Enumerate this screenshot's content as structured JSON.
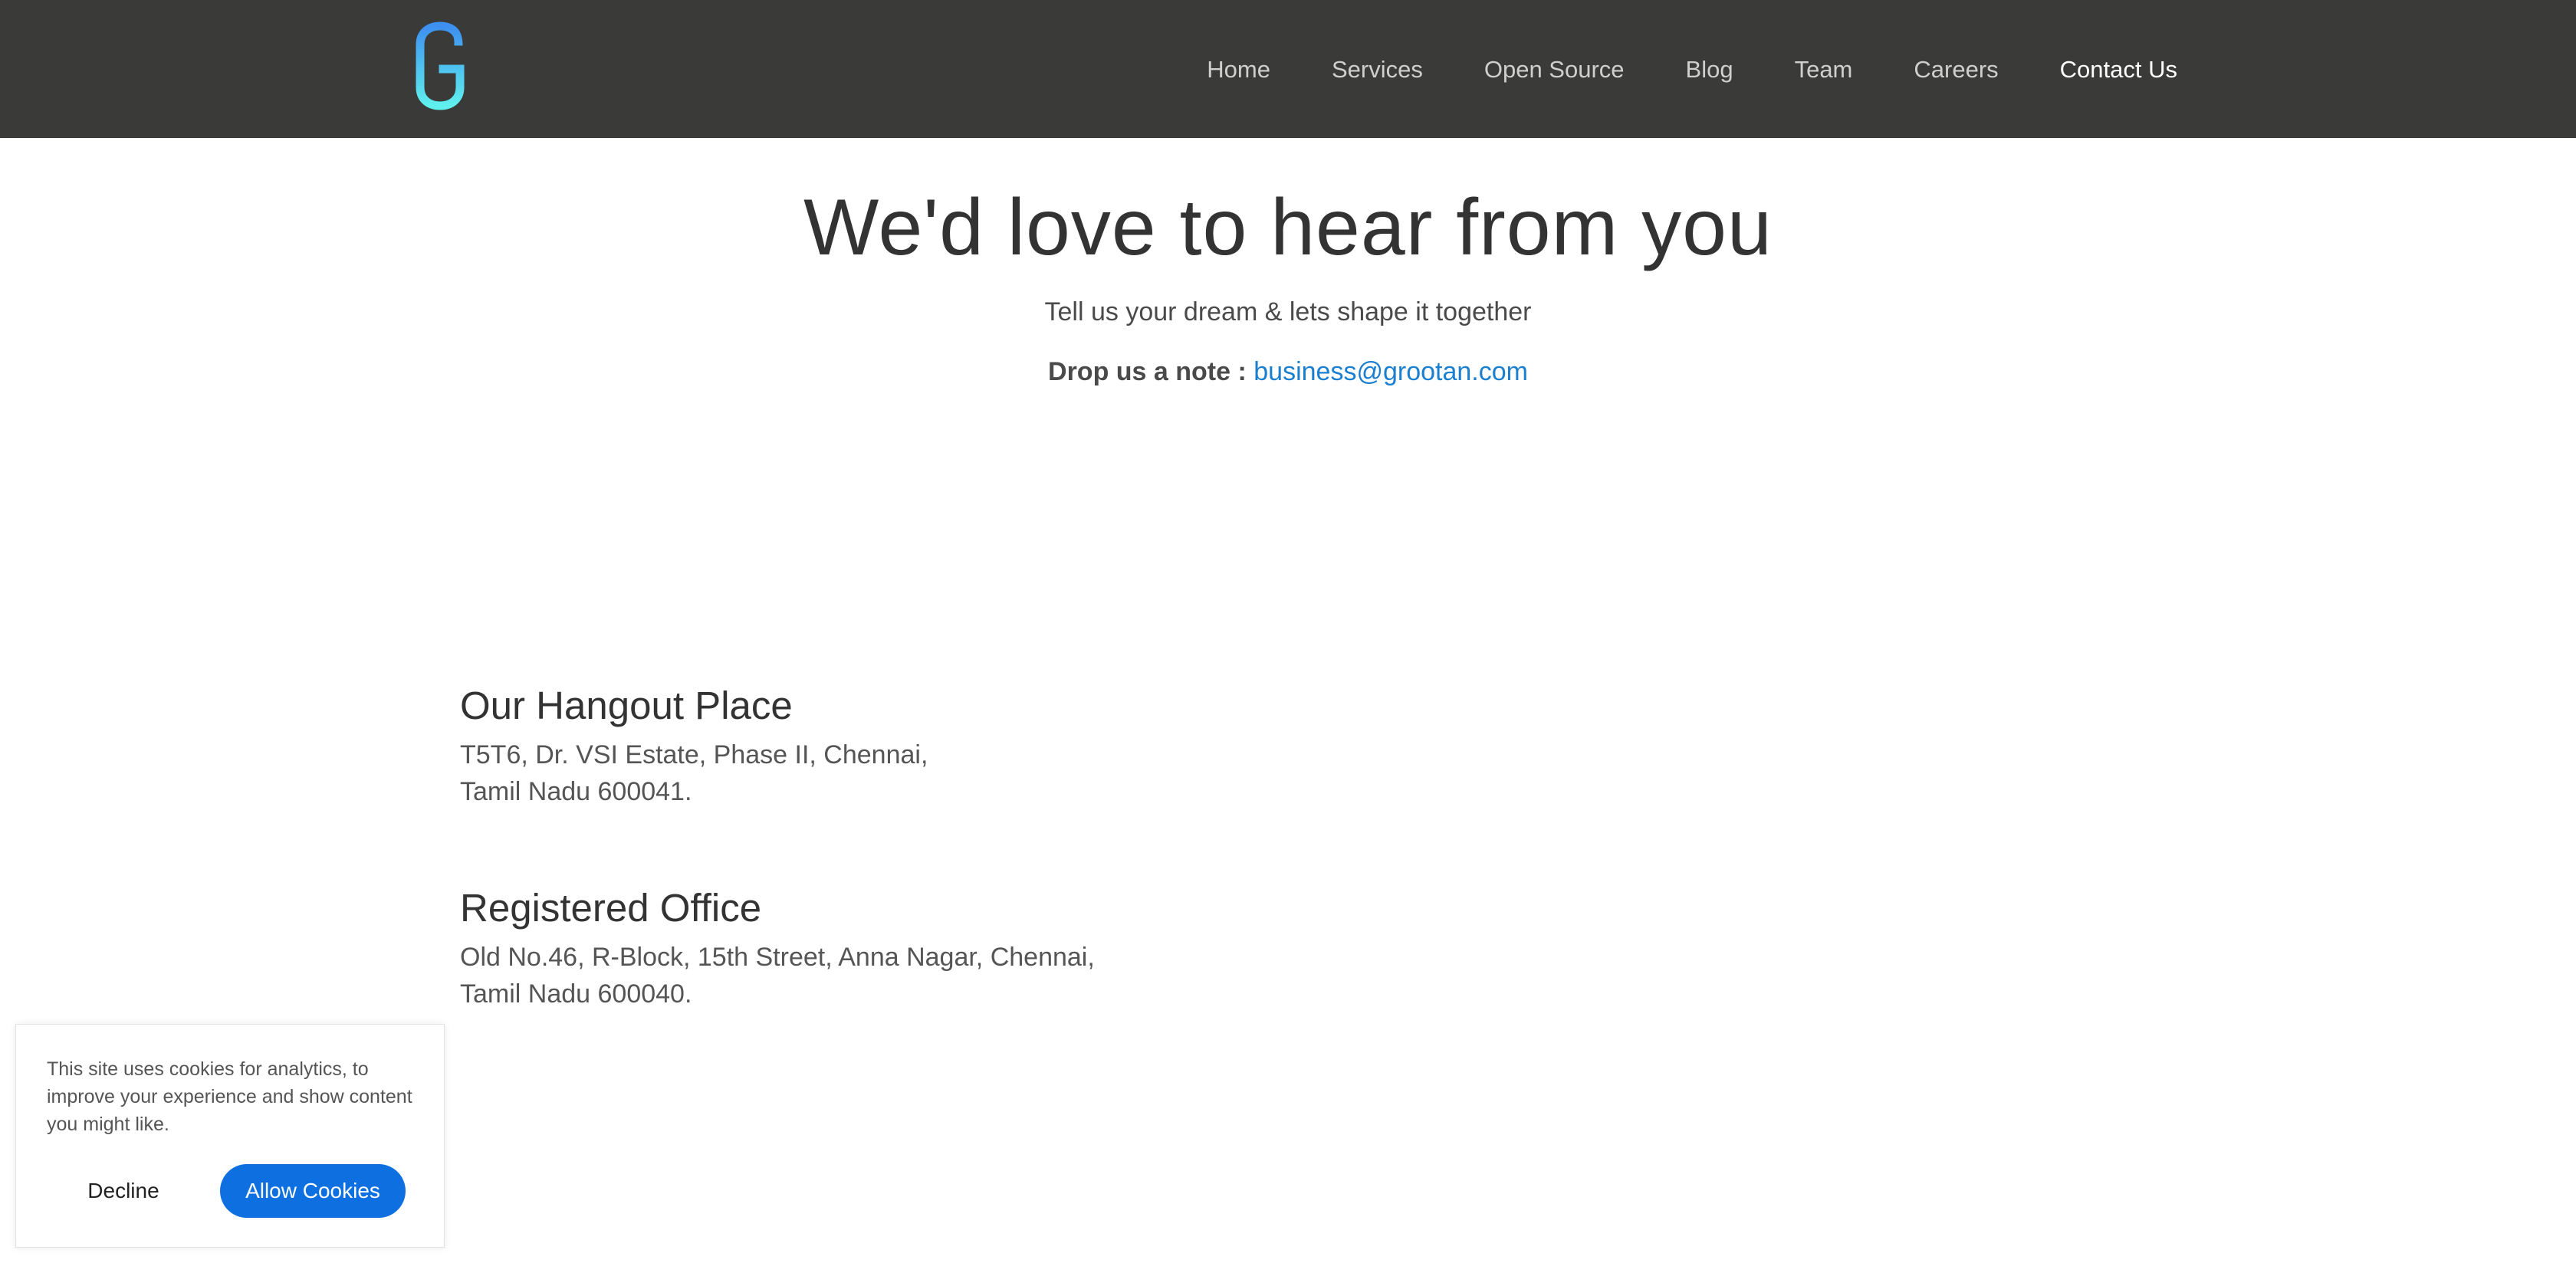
{
  "header": {
    "logo_icon": "grootan-g-logo",
    "nav": [
      {
        "label": "Home"
      },
      {
        "label": "Services"
      },
      {
        "label": "Open Source"
      },
      {
        "label": "Blog"
      },
      {
        "label": "Team"
      },
      {
        "label": "Careers"
      },
      {
        "label": "Contact Us",
        "active": true
      }
    ],
    "colors": {
      "bar": "#3a3a38",
      "logo_top": "#3d8ff0",
      "logo_bottom": "#5ff0ee"
    }
  },
  "hero": {
    "title": "We'd love to hear from you",
    "subtitle": "Tell us your dream & lets shape it together",
    "note_label": "Drop us a note :",
    "note_email": "business@grootan.com"
  },
  "locations": [
    {
      "title": "Our Hangout Place",
      "line1": "T5T6, Dr. VSI Estate, Phase II, Chennai,",
      "line2": "Tamil Nadu 600041."
    },
    {
      "title": "Registered Office",
      "line1": "Old No.46, R-Block, 15th Street, Anna Nagar, Chennai,",
      "line2": "Tamil Nadu 600040."
    }
  ],
  "cookie_banner": {
    "text": "This site uses cookies for analytics, to improve your experience and show content you might like.",
    "decline_label": "Decline",
    "allow_label": "Allow Cookies",
    "accent": "#0d6fe0"
  }
}
